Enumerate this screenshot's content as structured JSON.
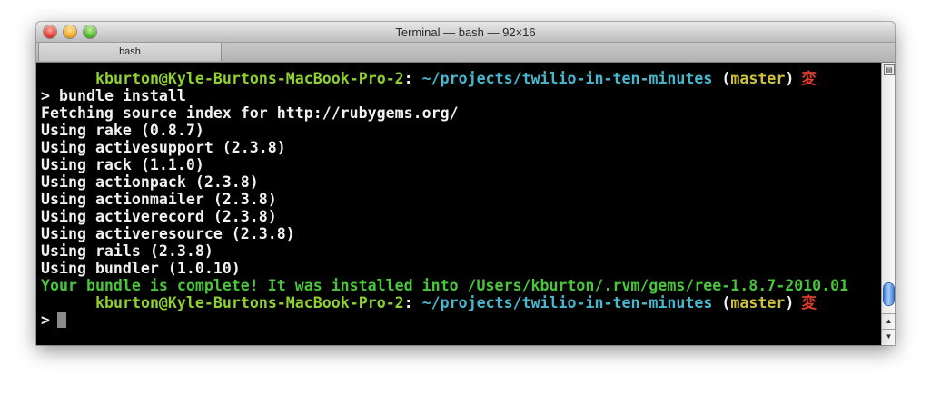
{
  "window": {
    "title": "Terminal — bash — 92×16",
    "tab_label": "bash"
  },
  "terminal": {
    "prompt1": {
      "user": "kburton@Kyle-Burtons-MacBook-Pro-2",
      "colon": ":",
      "path": "~/projects/twilio-in-ten-minutes",
      "open_paren": "(",
      "branch": "master",
      "close_paren": ")",
      "flag": "変"
    },
    "command_prompt": ">",
    "command": "bundle install",
    "output": [
      "Fetching source index for http://rubygems.org/",
      "Using rake (0.8.7)",
      "Using activesupport (2.3.8)",
      "Using rack (1.1.0)",
      "Using actionpack (2.3.8)",
      "Using actionmailer (2.3.8)",
      "Using activerecord (2.3.8)",
      "Using activeresource (2.3.8)",
      "Using rails (2.3.8)",
      "Using bundler (1.0.10)"
    ],
    "success": "Your bundle is complete! It was installed into /Users/kburton/.rvm/gems/ree-1.8.7-2010.01",
    "prompt2": {
      "user": "kburton@Kyle-Burtons-MacBook-Pro-2",
      "colon": ":",
      "path": "~/projects/twilio-in-ten-minutes",
      "open_paren": "(",
      "branch": "master",
      "close_paren": ")",
      "flag": "変"
    },
    "final_prompt": ">"
  },
  "colors": {
    "user": "#8fd12e",
    "path": "#47b7cf",
    "branch": "#cdc338",
    "flag": "#e03c2e",
    "success": "#49c63a",
    "background": "#000000"
  },
  "icons": {
    "close": "close-traffic-light-icon",
    "minimize": "minimize-traffic-light-icon",
    "zoom": "zoom-traffic-light-icon"
  }
}
